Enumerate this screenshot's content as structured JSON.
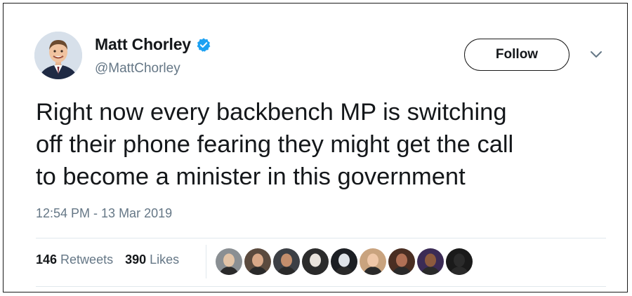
{
  "tweet": {
    "author": {
      "name": "Matt Chorley",
      "handle": "@MattChorley",
      "verified": true,
      "avatar_icon": "profile-photo"
    },
    "follow_label": "Follow",
    "menu_icon": "chevron-down-icon",
    "text_lines": [
      "Right now every backbench MP is switching",
      "off their phone fearing they might get the call",
      "to become a minister in this government"
    ],
    "timestamp": "12:54 PM - 13 Mar 2019",
    "stats": {
      "retweets_count": "146",
      "retweets_label": "Retweets",
      "likes_count": "390",
      "likes_label": "Likes"
    },
    "liker_avatars": [
      {
        "name": "liker-avatar-1",
        "bg": "#8a8f93",
        "skin": "#e2c3a6"
      },
      {
        "name": "liker-avatar-2",
        "bg": "#5b4a3e",
        "skin": "#d9a888"
      },
      {
        "name": "liker-avatar-3",
        "bg": "#3c3f45",
        "skin": "#c48e6c"
      },
      {
        "name": "liker-avatar-4",
        "bg": "#2c2c2c",
        "skin": "#e9e3dc"
      },
      {
        "name": "liker-avatar-5",
        "bg": "#1c1f24",
        "skin": "#dfe3e8"
      },
      {
        "name": "liker-avatar-6",
        "bg": "#c9a37e",
        "skin": "#efc7a8"
      },
      {
        "name": "liker-avatar-7",
        "bg": "#4a2e22",
        "skin": "#b07055"
      },
      {
        "name": "liker-avatar-8",
        "bg": "#3b2b55",
        "skin": "#8c5a3e"
      },
      {
        "name": "liker-avatar-9",
        "bg": "#1a1a1a",
        "skin": "#2b2b2b"
      }
    ]
  },
  "colors": {
    "text_primary": "#14171a",
    "text_secondary": "#657786",
    "verified_blue": "#1da1f2",
    "divider": "#e1e8ed"
  }
}
